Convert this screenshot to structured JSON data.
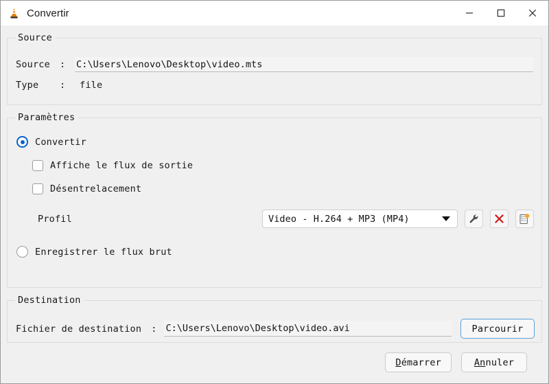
{
  "window": {
    "title": "Convertir",
    "icon": "vlc-cone-icon",
    "controls": {
      "minimize": "minimize-icon",
      "maximize": "maximize-icon",
      "close": "close-icon"
    }
  },
  "source_group": {
    "title": "Source",
    "source_label": "Source",
    "source_colon": ":",
    "source_value": "C:\\Users\\Lenovo\\Desktop\\video.mts",
    "type_label": "Type",
    "type_colon": ":",
    "type_value": "file"
  },
  "params_group": {
    "title": "Paramètres",
    "convert_radio": {
      "label": "Convertir",
      "selected": true
    },
    "display_output_checkbox": {
      "label": "Affiche le flux de sortie",
      "checked": false
    },
    "deinterlace_checkbox": {
      "label": "Désentrelacement",
      "checked": false
    },
    "profile_label": "Profil",
    "profile_value": "Video - H.264 + MP3 (MP4)",
    "profile_buttons": {
      "edit": "wrench-icon",
      "delete": "red-x-icon",
      "new": "new-profile-icon"
    },
    "raw_radio": {
      "label": "Enregistrer le flux brut",
      "selected": false
    }
  },
  "destination_group": {
    "title": "Destination",
    "file_label": "Fichier de destination",
    "file_colon": ":",
    "file_value": "C:\\Users\\Lenovo\\Desktop\\video.avi",
    "browse_label": "Parcourir"
  },
  "dialog_buttons": {
    "start_mnemonic": "D",
    "start_rest": "émarrer",
    "cancel_mnemonic": "An",
    "cancel_rest": "nuler"
  },
  "colors": {
    "accent_blue": "#0a63c9",
    "focus_border": "#5a9fd4",
    "delete_red": "#cc2222",
    "badge_orange": "#f5a623",
    "window_bg": "#f0f0f0",
    "titlebar_bg": "#ffffff"
  }
}
